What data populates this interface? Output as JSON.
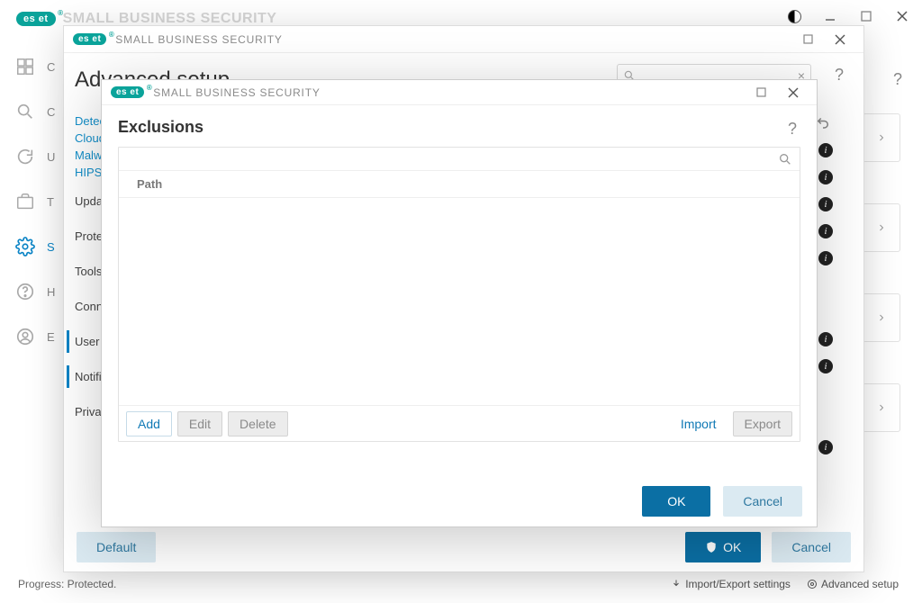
{
  "app": {
    "product": "SMALL BUSINESS SECURITY",
    "logo": "eset"
  },
  "win1": {
    "status_left": "Progress: Protected.",
    "footer_import": "Import/Export settings",
    "footer_advanced": "Advanced setup",
    "sidebar": [
      {
        "label": ""
      },
      {
        "label": "C"
      },
      {
        "label": "C"
      },
      {
        "label": "U"
      },
      {
        "label": "T"
      },
      {
        "label": "S"
      },
      {
        "label": "H"
      },
      {
        "label": "E"
      }
    ]
  },
  "win2": {
    "title": "Advanced setup",
    "search_placeholder": "",
    "tree": {
      "detection": "Detec",
      "cloud": "Cloud",
      "malware": "Malwa",
      "hips": "HIPS",
      "update": "Updat",
      "protections": "Prote",
      "tools": "Tools",
      "connect": "Conn",
      "user": "User i",
      "notifications": "Notifi",
      "privacy": "Privac"
    },
    "footer": {
      "default": "Default",
      "ok": "OK",
      "cancel": "Cancel"
    }
  },
  "win3": {
    "title": "Exclusions",
    "columns": {
      "path": "Path"
    },
    "toolbar": {
      "add": "Add",
      "edit": "Edit",
      "delete": "Delete",
      "import": "Import",
      "export": "Export"
    },
    "footer": {
      "ok": "OK",
      "cancel": "Cancel"
    }
  }
}
